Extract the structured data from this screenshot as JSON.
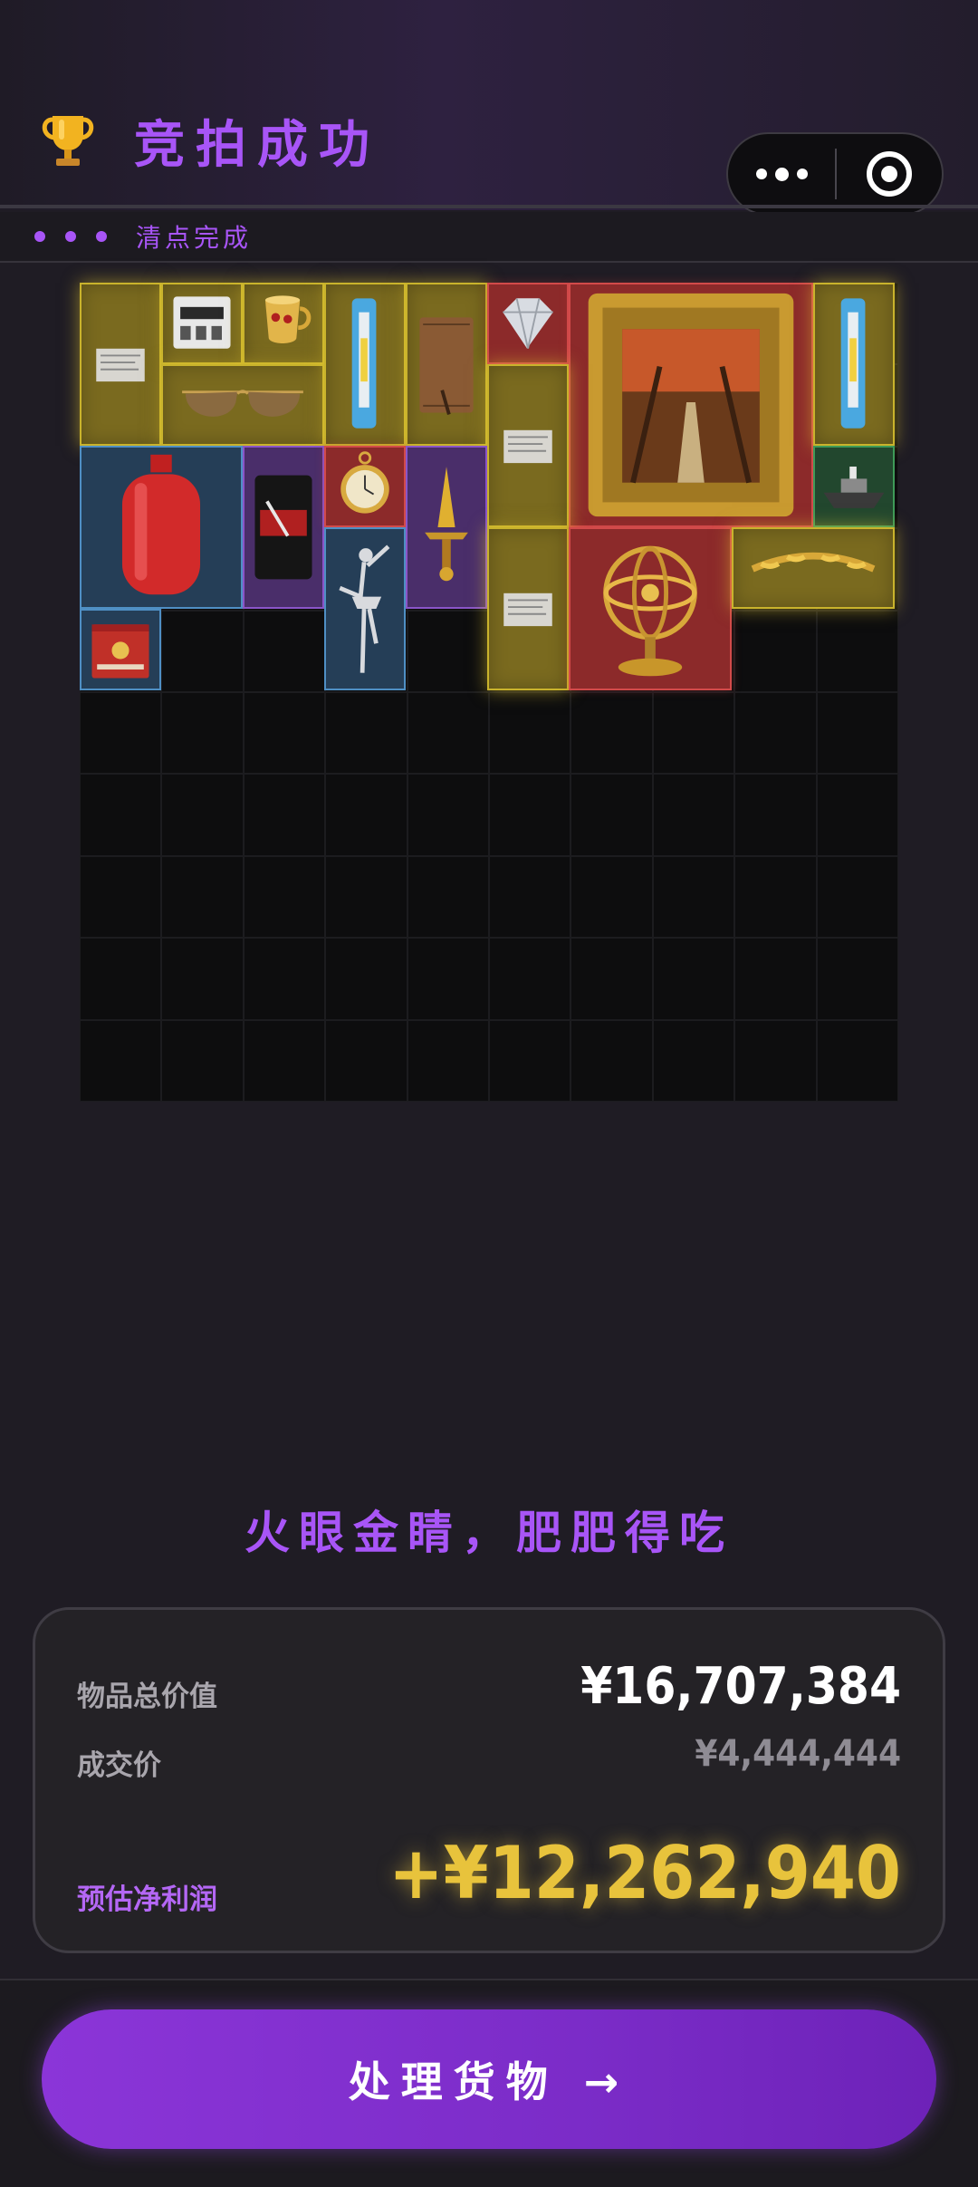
{
  "header": {
    "title": "竞拍成功",
    "trophy_icon": "trophy-icon",
    "more_icon": "more-dots-icon",
    "target_icon": "target-icon"
  },
  "subbar": {
    "status": "清点完成"
  },
  "grid": {
    "columns": 10,
    "rows": 10,
    "items": [
      {
        "name": "item-paper-document",
        "rarity": "yellow",
        "icon": "paper-icon"
      },
      {
        "name": "item-electric-meter",
        "rarity": "yellow",
        "icon": "electric-meter-icon"
      },
      {
        "name": "item-gold-cup",
        "rarity": "yellow",
        "icon": "gold-cup-icon"
      },
      {
        "name": "item-aviator-sunglasses",
        "rarity": "yellow",
        "icon": "sunglasses-icon"
      },
      {
        "name": "item-syringe",
        "rarity": "yellow",
        "icon": "syringe-icon"
      },
      {
        "name": "item-leather-notebook",
        "rarity": "yellow",
        "icon": "notebook-icon"
      },
      {
        "name": "item-diamond",
        "rarity": "red",
        "icon": "diamond-icon"
      },
      {
        "name": "item-oil-painting",
        "rarity": "red",
        "icon": "painting-icon"
      },
      {
        "name": "item-syringe-2",
        "rarity": "yellow",
        "icon": "syringe-icon"
      },
      {
        "name": "item-paper-document-2",
        "rarity": "yellow",
        "icon": "paper-icon"
      },
      {
        "name": "item-gas-cylinder",
        "rarity": "blue",
        "icon": "gas-cylinder-icon"
      },
      {
        "name": "item-coffee-bag",
        "rarity": "purple",
        "icon": "coffee-bag-icon"
      },
      {
        "name": "item-pocket-watch",
        "rarity": "red",
        "icon": "pocket-watch-icon"
      },
      {
        "name": "item-golden-dagger",
        "rarity": "purple",
        "icon": "dagger-icon"
      },
      {
        "name": "item-ship-model",
        "rarity": "green",
        "icon": "ship-icon"
      },
      {
        "name": "item-ballerina-statue",
        "rarity": "blue",
        "icon": "ballerina-icon"
      },
      {
        "name": "item-paper-document-3",
        "rarity": "yellow",
        "icon": "paper-icon"
      },
      {
        "name": "item-armillary-sphere",
        "rarity": "red",
        "icon": "armillary-sphere-icon"
      },
      {
        "name": "item-laurel-crown",
        "rarity": "yellow",
        "icon": "laurel-crown-icon"
      },
      {
        "name": "item-red-tin-box",
        "rarity": "blue",
        "icon": "tin-box-icon"
      }
    ]
  },
  "slogan": "火眼金睛，肥肥得吃",
  "summary": {
    "total_label": "物品总价值",
    "total_value": "¥16,707,384",
    "deal_label": "成交价",
    "deal_value": "¥4,444,444",
    "profit_label": "预估净利润",
    "profit_value": "+¥12,262,940"
  },
  "cta": {
    "label": "处理货物 →"
  },
  "colors": {
    "accent": "#a855f7",
    "gold": "#e8c33c",
    "rarity_yellow": "#c9b32c",
    "rarity_red": "#d24a4a",
    "rarity_blue": "#4f8fc4",
    "rarity_purple": "#8a55c8",
    "rarity_green": "#3e9a58"
  }
}
